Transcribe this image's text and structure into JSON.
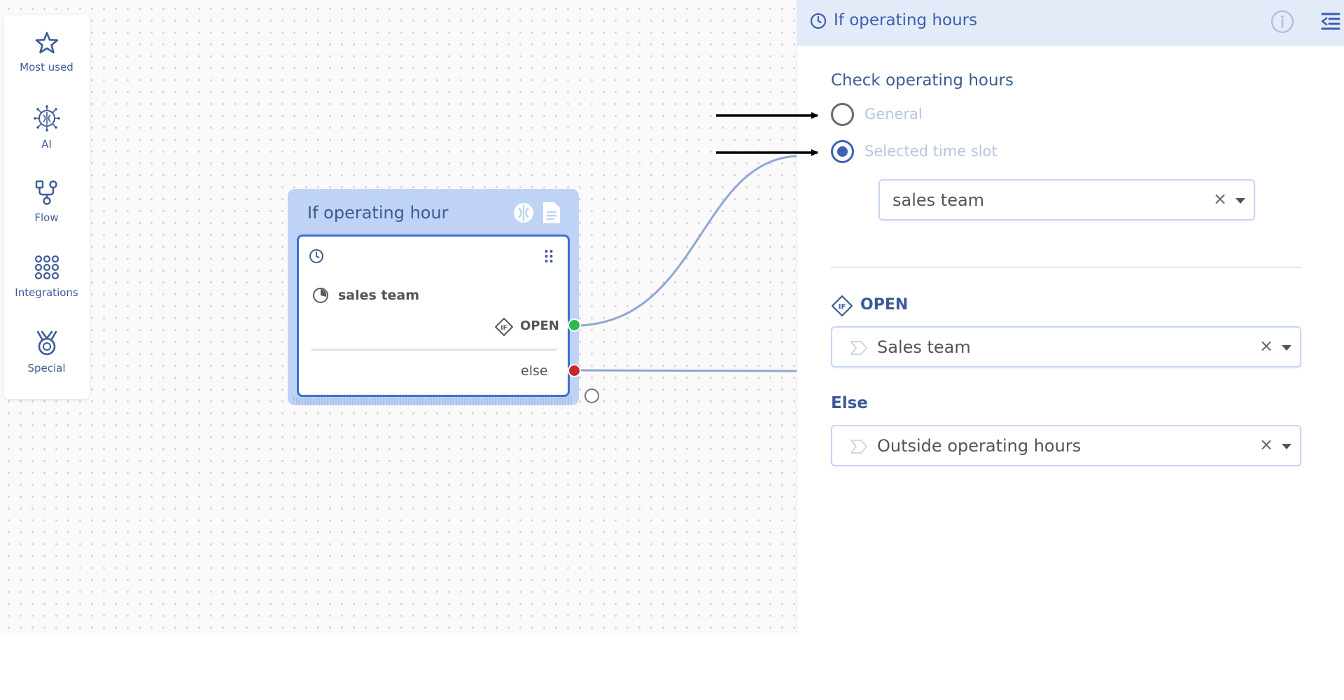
{
  "palette": {
    "items": [
      {
        "label": "Most used",
        "icon": "star-icon"
      },
      {
        "label": "AI",
        "icon": "ai-brain-icon"
      },
      {
        "label": "Flow",
        "icon": "flow-icon"
      },
      {
        "label": "Integrations",
        "icon": "grid-dots-icon"
      },
      {
        "label": "Special",
        "icon": "medal-icon"
      }
    ]
  },
  "node": {
    "title": "If operating hour",
    "team": "sales team",
    "open_label": "OPEN",
    "else_label": "else"
  },
  "panel": {
    "title": "If operating hours",
    "section_label": "Check operating hours",
    "radio_general": "General",
    "radio_selected_slot": "Selected time slot",
    "selected_option": "Selected time slot",
    "timeslot_value": "sales team",
    "open_label": "OPEN",
    "open_target": "Sales team",
    "else_label": "Else",
    "else_target": "Outside operating hours",
    "clear_glyph": "×"
  },
  "colors": {
    "accent": "#3c63b5",
    "node_bg": "#bed3f5",
    "port_open": "#2fb84e",
    "port_else": "#c8282b",
    "wire": "#8fa8d2"
  }
}
